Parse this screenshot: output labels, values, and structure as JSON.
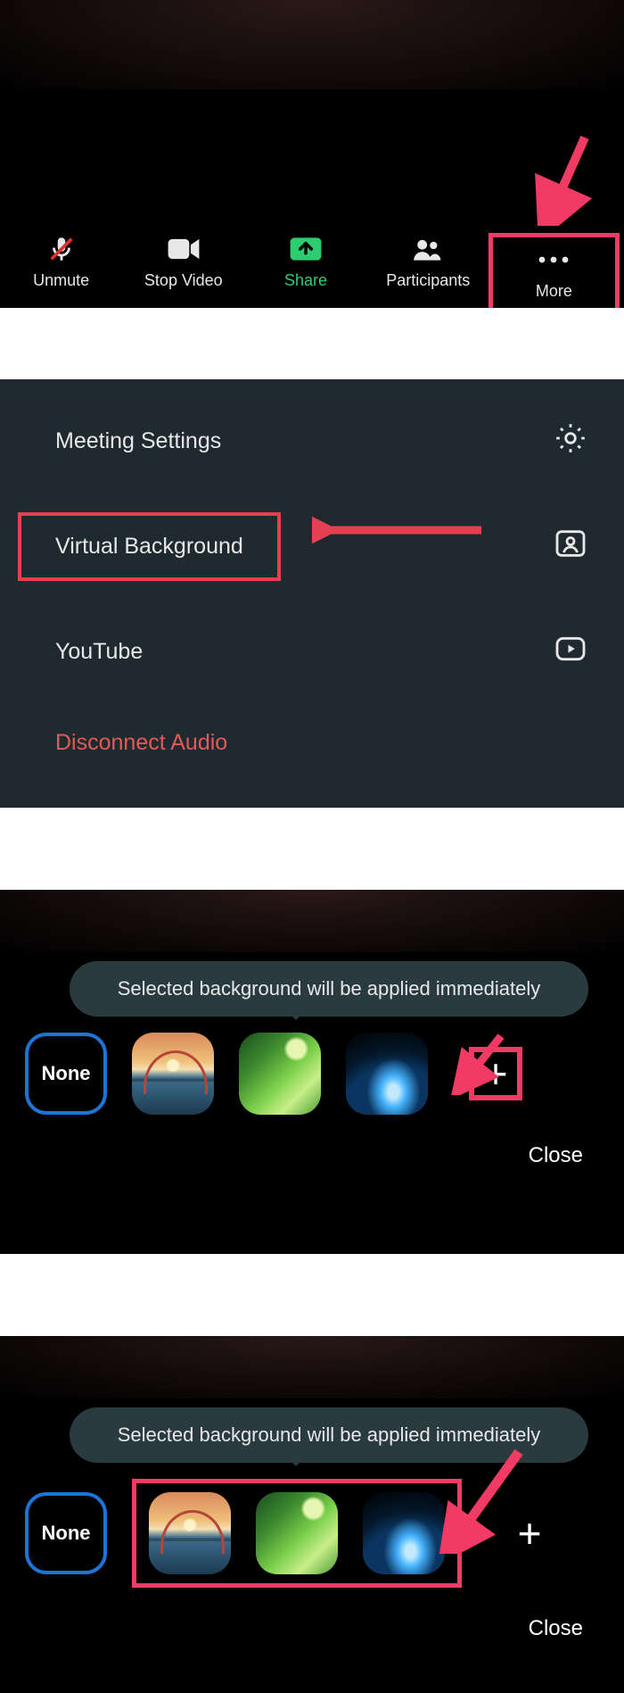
{
  "toolbar": {
    "unmute": "Unmute",
    "stop_video": "Stop Video",
    "share": "Share",
    "participants": "Participants",
    "more": "More"
  },
  "menu": {
    "meeting_settings": "Meeting Settings",
    "virtual_background": "Virtual Background",
    "youtube": "YouTube",
    "disconnect_audio": "Disconnect Audio"
  },
  "bg_picker": {
    "tooltip": "Selected background will be applied immediately",
    "none": "None",
    "close": "Close",
    "thumbs": [
      "bridge",
      "grass",
      "earth"
    ]
  },
  "annotation_color": "#f13a64"
}
